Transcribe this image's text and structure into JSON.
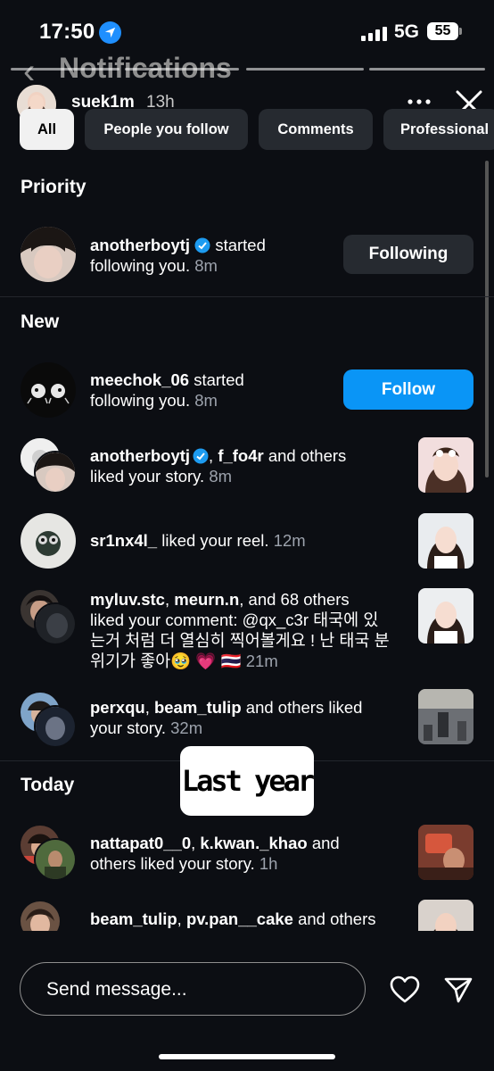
{
  "status": {
    "time": "17:50",
    "network": "5G",
    "battery": "55"
  },
  "header": {
    "title": "Notifications"
  },
  "story": {
    "username": "suek1m",
    "time": "13h"
  },
  "filters": [
    "All",
    "People you follow",
    "Comments",
    "Professional"
  ],
  "sections": {
    "priority": "Priority",
    "new": "New",
    "today": "Today"
  },
  "notifications": [
    {
      "user": "anotherboytj",
      "text_a": "started",
      "text_b": "following you.",
      "time": "8m",
      "button": "Following"
    },
    {
      "user": "meechok_06",
      "text_a": "started",
      "text_b": "following you.",
      "time": "8m",
      "button": "Follow"
    },
    {
      "user": "anotherboytj",
      "user2": "f_fo4r",
      "text_a": "and others",
      "text_b": "liked your story.",
      "time": "8m"
    },
    {
      "user": "sr1nx4l_",
      "text_a": "liked your reel.",
      "time": "12m"
    },
    {
      "user": "myluv.stc",
      "user2": "meurn.n",
      "text_a": "and 68 others",
      "text_b": "liked your comment: @qx_c3r 태국에 있",
      "text_c": "는거 처럼 더 열심히 찍어볼게요 ! 난 태국 분",
      "text_d": "위기가 좋아🥹 💗 🇹🇭",
      "time": "21m"
    },
    {
      "user": "perxqu",
      "user2": "beam_tulip",
      "text_a": "and others liked",
      "text_b": "your story.",
      "time": "32m"
    },
    {
      "user": "nattapat0__0",
      "user2": "k.kwan._khao",
      "text_a": "and",
      "text_b": "others liked your story.",
      "time": "1h"
    },
    {
      "user": "beam_tulip",
      "user2": "pv.pan__cake",
      "text_a": "and others"
    }
  ],
  "sticker": "Last year",
  "message": {
    "placeholder": "Send message..."
  }
}
